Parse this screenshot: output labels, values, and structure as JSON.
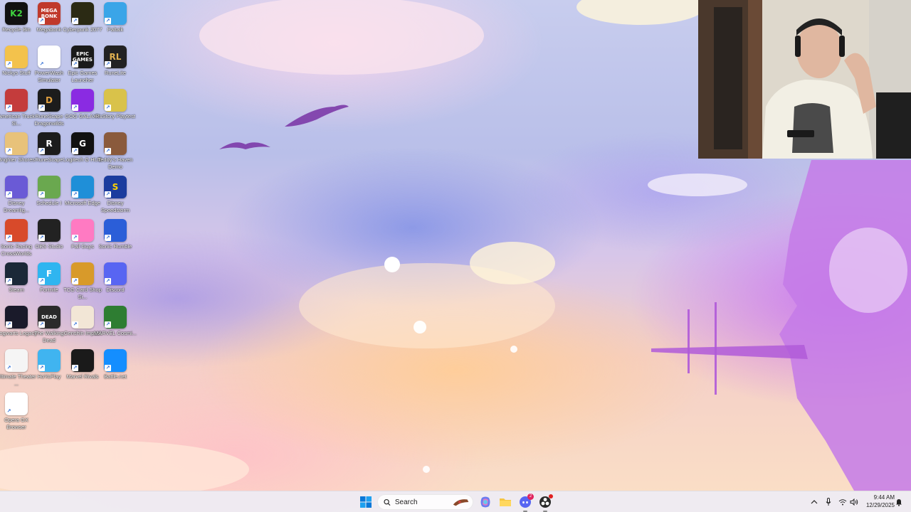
{
  "desktop": {
    "icons": [
      {
        "label": "Recycle Bin",
        "tile": "K2",
        "bg": "#111111",
        "fg": "#3fd13f"
      },
      {
        "label": "Megabonk",
        "tile": "MEGA BONK",
        "bg": "#c0392b",
        "fg": "#ffffff"
      },
      {
        "label": "Cyberpunk 2077",
        "tile": "",
        "bg": "#2b2a14",
        "fg": "#e7e03b"
      },
      {
        "label": "Paltalk",
        "tile": "",
        "bg": "#3aa5e8",
        "fg": "#ffffff"
      },
      {
        "label": "Nickys Stuff",
        "tile": "",
        "bg": "#f3c24c",
        "fg": "#ffffff"
      },
      {
        "label": "PowerWash Simulator",
        "tile": "",
        "bg": "#ffffff",
        "fg": "#2b7bd6"
      },
      {
        "label": "Epic Games Launcher",
        "tile": "EPIC GAMES",
        "bg": "#1a1a1a",
        "fg": "#ffffff"
      },
      {
        "label": "RuneLite",
        "tile": "RL",
        "bg": "#222222",
        "fg": "#e0b050"
      },
      {
        "label": "American Truck Si...",
        "tile": "",
        "bg": "#c43c3c",
        "fg": "#ffffff"
      },
      {
        "label": "RuneScape Dragonwilds",
        "tile": "D",
        "bg": "#1c1c1c",
        "fg": "#e0a040"
      },
      {
        "label": "GOG GALAXY",
        "tile": "",
        "bg": "#8a2be2",
        "fg": "#ffffff"
      },
      {
        "label": "RuStory Playtest",
        "tile": "",
        "bg": "#d9c24a",
        "fg": "#7a3f10"
      },
      {
        "label": "Brighter Shores",
        "tile": "",
        "bg": "#e8c27a",
        "fg": "#ffffff"
      },
      {
        "label": "RuneScape",
        "tile": "R",
        "bg": "#1c1c1c",
        "fg": "#ffffff"
      },
      {
        "label": "Logitech G HUB",
        "tile": "G",
        "bg": "#111111",
        "fg": "#ffffff"
      },
      {
        "label": "Teddy's Haven Demo",
        "tile": "",
        "bg": "#8a5a3c",
        "fg": "#ffffff"
      },
      {
        "label": "Disney Dreamlig...",
        "tile": "",
        "bg": "#6a5ad6",
        "fg": "#ffffff"
      },
      {
        "label": "Schedule I",
        "tile": "",
        "bg": "#6aa84f",
        "fg": "#ffffff"
      },
      {
        "label": "Microsoft Edge",
        "tile": "",
        "bg": "#1f8fd8",
        "fg": "#ffffff"
      },
      {
        "label": "Disney Speedstorm",
        "tile": "S",
        "bg": "#1b3c9e",
        "fg": "#ffd400"
      },
      {
        "label": "Sonic Racing CrossWorlds",
        "tile": "",
        "bg": "#d84a2a",
        "fg": "#ffffff"
      },
      {
        "label": "OBS Studio",
        "tile": "",
        "bg": "#222222",
        "fg": "#ffffff"
      },
      {
        "label": "Fall Guys",
        "tile": "",
        "bg": "#ff7ac2",
        "fg": "#ffffff"
      },
      {
        "label": "Sonic Rumble",
        "tile": "",
        "bg": "#2b5ed8",
        "fg": "#ffffff"
      },
      {
        "label": "Steam",
        "tile": "",
        "bg": "#1b2838",
        "fg": "#ffffff"
      },
      {
        "label": "Fortnite",
        "tile": "F",
        "bg": "#2fb5f0",
        "fg": "#ffffff"
      },
      {
        "label": "TCG Card Shop Si...",
        "tile": "",
        "bg": "#d89a2a",
        "fg": "#ffffff"
      },
      {
        "label": "Discord",
        "tile": "",
        "bg": "#5865f2",
        "fg": "#ffffff"
      },
      {
        "label": "Hogwarts Legacy",
        "tile": "",
        "bg": "#1a1a2a",
        "fg": "#c9b56a"
      },
      {
        "label": "The Walking Dead",
        "tile": "DEAD",
        "bg": "#2a2a2a",
        "fg": "#ffffff"
      },
      {
        "label": "Genshin Impact",
        "tile": "",
        "bg": "#f2e6d6",
        "fg": "#7a5a3a"
      },
      {
        "label": "MARVEL Cosmi...",
        "tile": "",
        "bg": "#2e7d32",
        "fg": "#ffffff"
      },
      {
        "label": "Ultimate Theater ...",
        "tile": "",
        "bg": "#f5f5f5",
        "fg": "#c62828"
      },
      {
        "label": "HoYoPlay",
        "tile": "",
        "bg": "#40b4f0",
        "fg": "#ffffff"
      },
      {
        "label": "Marvel Rivals",
        "tile": "",
        "bg": "#1a1a1a",
        "fg": "#f5d000"
      },
      {
        "label": "Battle.net",
        "tile": "",
        "bg": "#148eff",
        "fg": "#ffffff"
      },
      {
        "label": "Opera GX Browser",
        "tile": "",
        "bg": "#ffffff",
        "fg": "#e0203a"
      }
    ]
  },
  "taskbar": {
    "search_placeholder": "Search",
    "clock_time": "9:44 AM",
    "clock_date": "12/29/2025",
    "discord_badge": "2",
    "accent": "#0078d4"
  }
}
